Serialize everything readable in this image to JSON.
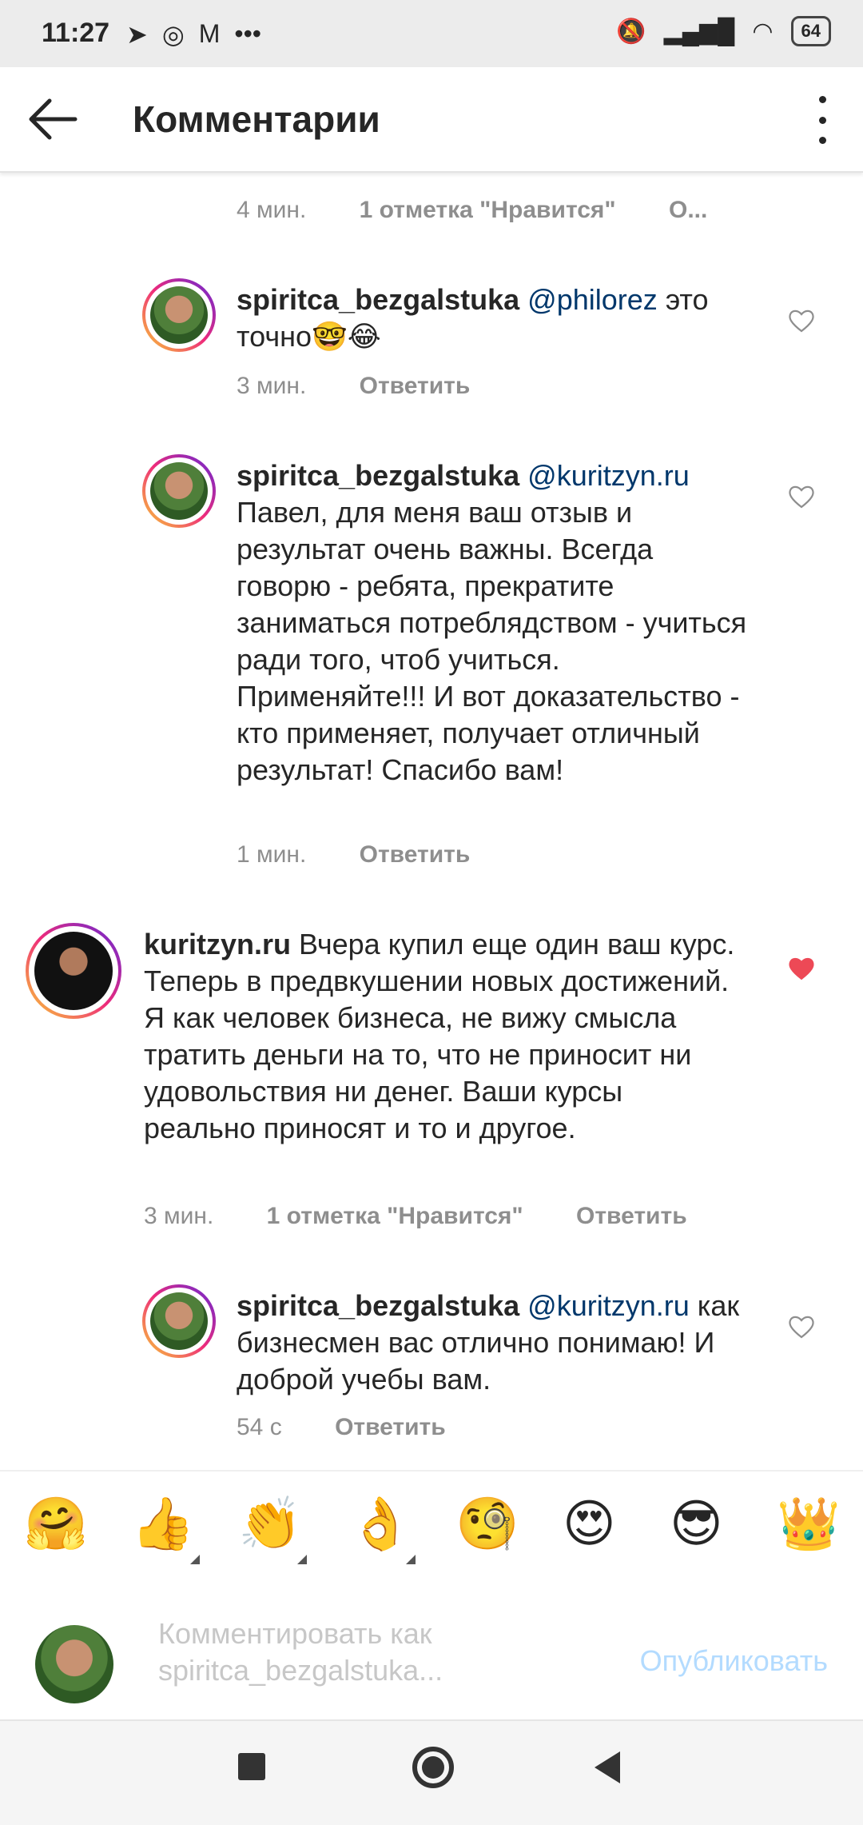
{
  "status_bar": {
    "time": "11:27",
    "battery": "64",
    "left_icons": [
      "telegram-icon",
      "instagram-icon",
      "gmail-icon",
      "more-dots-icon"
    ],
    "right_icons": [
      "mute-icon",
      "signal-icon",
      "wifi-icon",
      "battery-icon"
    ]
  },
  "header": {
    "title": "Комментарии"
  },
  "comments": [
    {
      "time": "4 мин.",
      "likes": "1 отметка \"Нравится\"",
      "reply": "О..."
    },
    {
      "username": "spiritca_bezgalstuka",
      "mention": "@philorez",
      "text": "это точно🤓😂",
      "time": "3 мин.",
      "reply": "Ответить",
      "liked": false
    },
    {
      "username": "spiritca_bezgalstuka",
      "mention": "@kuritzyn.ru",
      "text": "Павел, для меня ваш отзыв и результат очень важны. Всегда говорю - ребята, прекратите заниматься потреблядством - учиться ради того, чтоб учиться. Применяйте!!! И вот доказательство - кто применяет, получает отличный результат! Спасибо вам!",
      "time": "1 мин.",
      "reply": "Ответить",
      "liked": false
    },
    {
      "username": "kuritzyn.ru",
      "text": "Вчера купил еще один ваш курс. Теперь в предвкушении новых достижений. Я как человек бизнеса, не вижу смысла тратить деньги на то, что не приносит ни удовольствия ни денег. Ваши курсы реально приносят и то и другое.",
      "time": "3 мин.",
      "likes": "1 отметка \"Нравится\"",
      "reply": "Ответить",
      "liked": true
    },
    {
      "username": "spiritca_bezgalstuka",
      "mention": "@kuritzyn.ru",
      "text": "как бизнесмен вас отлично понимаю! И доброй учебы вам.",
      "time": "54 с",
      "reply": "Ответить",
      "liked": false
    }
  ],
  "emoji_bar": [
    "🤗",
    "👍",
    "👏",
    "👌",
    "🧐",
    "😍",
    "😎",
    "👑"
  ],
  "comment_input": {
    "placeholder": "Комментировать как spiritca_bezgalstuka...",
    "publish": "Опубликовать"
  },
  "colors": {
    "like_red": "#ed4956",
    "publish_disabled": "#b3dbff",
    "mention": "#00376b"
  }
}
